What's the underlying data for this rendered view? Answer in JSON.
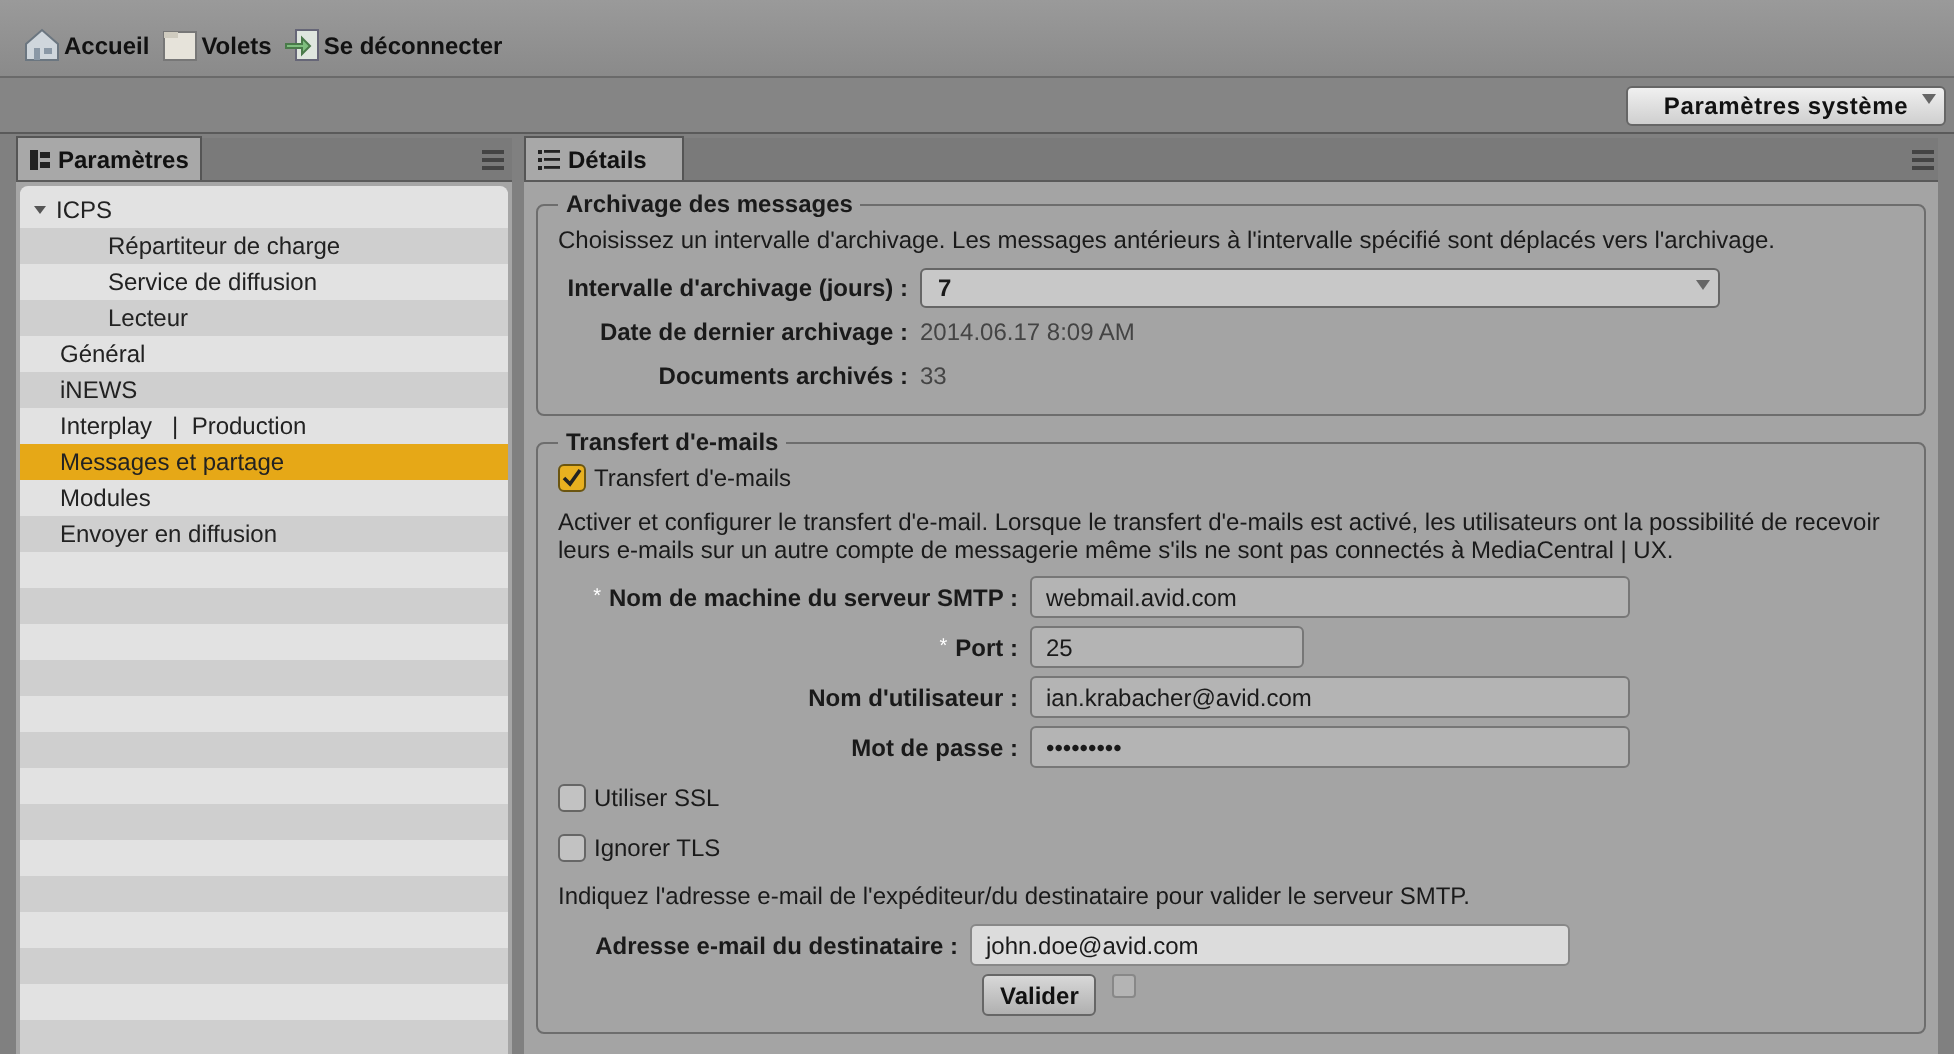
{
  "toolbar": {
    "items": [
      {
        "kind": "home",
        "label": "Accueil"
      },
      {
        "kind": "panes",
        "label": "Volets"
      },
      {
        "kind": "logout",
        "label": "Se déconnecter"
      }
    ]
  },
  "system_dropdown": {
    "value": "Paramètres système"
  },
  "left_panel": {
    "tab": "Paramètres",
    "tree": [
      {
        "label": "ICPS",
        "expanded": true,
        "selected": false,
        "children": [
          {
            "label": "Répartiteur de charge",
            "selected": false
          },
          {
            "label": "Service de diffusion",
            "selected": false
          },
          {
            "label": "Lecteur",
            "selected": false
          }
        ]
      },
      {
        "label": "Général",
        "selected": false
      },
      {
        "label": "iNEWS",
        "selected": false
      },
      {
        "label": "Interplay   |  Production",
        "selected": false
      },
      {
        "label": "Messages et partage",
        "selected": true
      },
      {
        "label": "Modules",
        "selected": false
      },
      {
        "label": "Envoyer en diffusion",
        "selected": false
      }
    ]
  },
  "right_panel": {
    "tab": "Détails",
    "archive": {
      "title": "Archivage des messages",
      "description": "Choisissez un intervalle d'archivage. Les messages antérieurs à l'intervalle spécifié sont déplacés vers l'archivage.",
      "interval_label": "Intervalle d'archivage (jours) :",
      "interval_value": "7",
      "last_label": "Date de dernier archivage :",
      "last_value": "2014.06.17 8:09 AM",
      "count_label": "Documents archivés :",
      "count_value": "33"
    },
    "forwarding": {
      "title": "Transfert d'e-mails",
      "enable": {
        "label": "Transfert d'e-mails",
        "checked": true
      },
      "description": "Activer et configurer le transfert d'e-mail. Lorsque le transfert d'e-mails est activé, les utilisateurs ont la possibilité de recevoir leurs e-mails sur un autre compte de messagerie même s'ils ne sont pas connectés à MediaCentral | UX.",
      "fields": [
        {
          "marker": "*",
          "label": "Nom de machine du serveur SMTP :",
          "value": "webmail.avid.com",
          "kind": "long"
        },
        {
          "marker": "*",
          "label": "Port :",
          "value": "25",
          "kind": "short"
        },
        {
          "label": "Nom d'utilisateur :",
          "value": "ian.krabacher@avid.com",
          "kind": "long"
        },
        {
          "label": "Mot de passe :",
          "value": "•••••••••",
          "kind": "long"
        }
      ],
      "options": [
        {
          "label": "Utiliser SSL",
          "checked": false
        },
        {
          "label": "Ignorer TLS",
          "checked": false
        }
      ],
      "validate_hint": "Indiquez l'adresse e-mail de l'expéditeur/du destinataire pour valider le serveur SMTP.",
      "recipient_label": "Adresse e-mail du destinataire :",
      "recipient_value": "john.doe@avid.com",
      "validate_button": "Valider",
      "validated": false
    }
  }
}
